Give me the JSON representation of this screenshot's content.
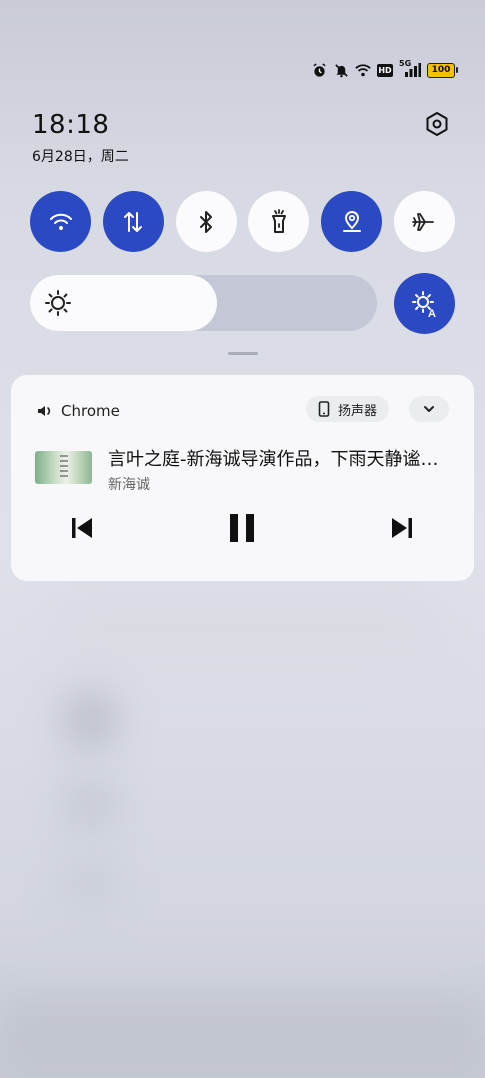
{
  "status_bar": {
    "icons": [
      "alarm-icon",
      "mute-icon",
      "wifi-icon",
      "hd-icon",
      "5g-signal-icon"
    ],
    "network_label": "5G",
    "hd_label": "HD",
    "battery": "100"
  },
  "header": {
    "time": "18:18",
    "date": "6月28日，周二"
  },
  "quick_tiles": [
    {
      "name": "wifi-tile",
      "icon": "wifi-icon",
      "on": true
    },
    {
      "name": "mobile-data-tile",
      "icon": "data-arrows-icon",
      "on": true
    },
    {
      "name": "bluetooth-tile",
      "icon": "bluetooth-icon",
      "on": false
    },
    {
      "name": "flashlight-tile",
      "icon": "flashlight-icon",
      "on": false
    },
    {
      "name": "location-tile",
      "icon": "location-icon",
      "on": true
    },
    {
      "name": "airplane-tile",
      "icon": "airplane-icon",
      "on": false
    }
  ],
  "brightness": {
    "level": 0.54
  },
  "media": {
    "source": "Chrome",
    "output_device": "扬声器",
    "title": "言叶之庭-新海诚导演作品，下雨天静谧的城市…",
    "artist": "新海诚"
  },
  "colors": {
    "accent": "#2a49c3",
    "tile_off": "#fbfbfd",
    "card": "#f8f8fa"
  }
}
